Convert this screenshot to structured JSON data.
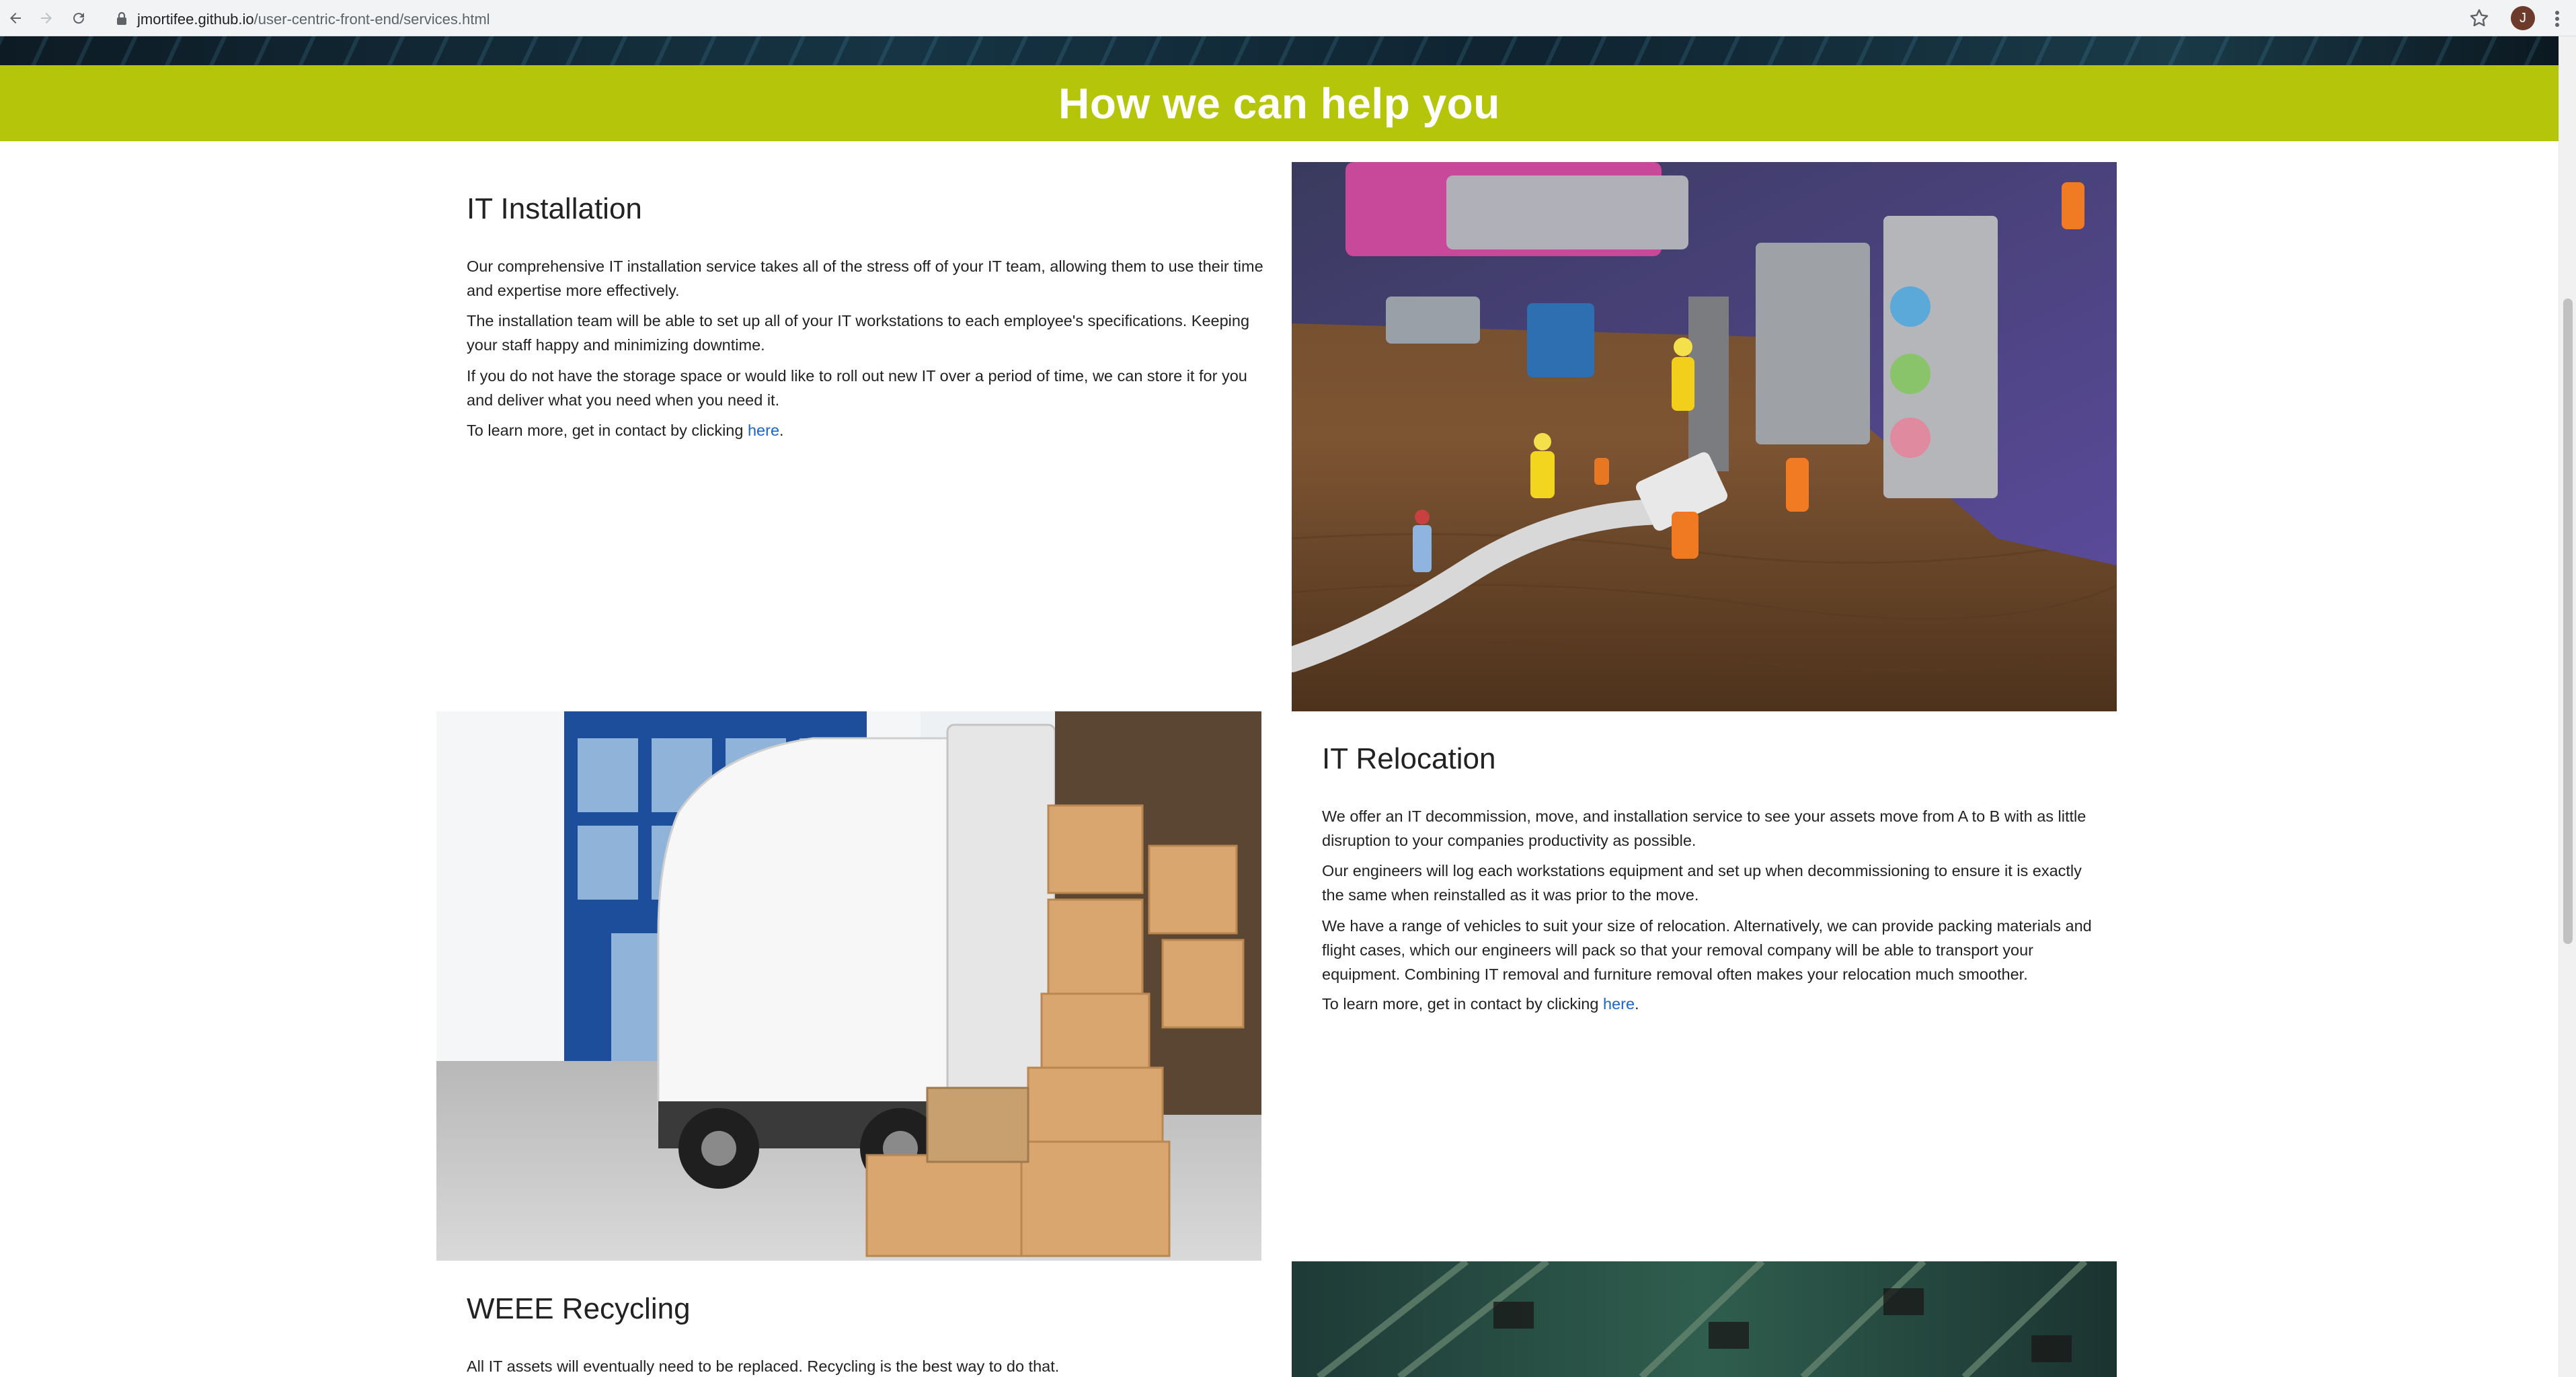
{
  "browser": {
    "url_host": "jmortifee.github.io",
    "url_path": "/user-centric-front-end/services.html",
    "profile_initial": "J"
  },
  "page": {
    "banner_title": "How we can help you",
    "services": [
      {
        "title": "IT Installation",
        "paragraphs": [
          "Our comprehensive IT installation service takes all of the stress off of your IT team, allowing them to use their time and expertise more effectively.",
          "The installation team will be able to set up all of your IT workstations to each employee's specifications. Keeping your staff happy and minimizing downtime.",
          "If you do not have the storage space or would like to roll out new IT over a period of time, we can store it for you and deliver what you need when you need it."
        ],
        "contact_prefix": "To learn more, get in contact by clicking ",
        "contact_link": "here",
        "contact_suffix": "."
      },
      {
        "title": "IT Relocation",
        "paragraphs": [
          "We offer an IT decommission, move, and installation service to see your assets move from A to B with as little disruption to your companies productivity as possible.",
          "Our engineers will log each workstations equipment and set up when decommissioning to ensure it is exactly the same when reinstalled as it was prior to the move.",
          "We have a range of vehicles to suit your size of relocation. Alternatively, we can provide packing materials and flight cases, which our engineers will pack so that your removal company will be able to transport your equipment. Combining IT removal and furniture removal often makes your relocation much smoother."
        ],
        "contact_prefix": "To learn more, get in contact by clicking ",
        "contact_link": "here",
        "contact_suffix": "."
      },
      {
        "title": "WEEE Recycling",
        "paragraphs": [
          "All IT assets will eventually need to be replaced. Recycling is the best way to do that."
        ]
      }
    ]
  },
  "icons": [
    "back-arrow-icon",
    "forward-arrow-icon",
    "reload-icon",
    "lock-icon",
    "star-icon",
    "menu-dots-icon"
  ],
  "colors": {
    "banner": "#b5c60a",
    "link": "#1a66c8",
    "text": "#222222"
  }
}
